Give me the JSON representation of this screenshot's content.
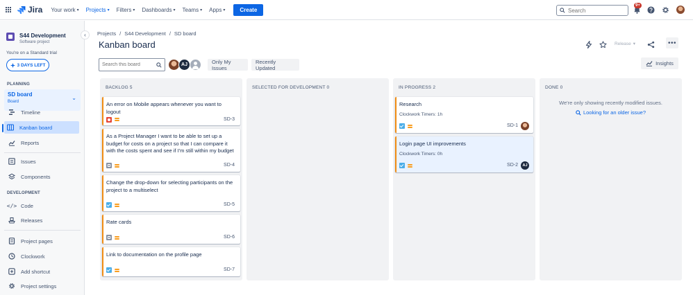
{
  "topnav": {
    "logo_text": "Jira",
    "items": [
      {
        "label": "Your work"
      },
      {
        "label": "Projects"
      },
      {
        "label": "Filters"
      },
      {
        "label": "Dashboards"
      },
      {
        "label": "Teams"
      },
      {
        "label": "Apps"
      }
    ],
    "create_label": "Create",
    "search_placeholder": "Search",
    "notifications_badge": "9+"
  },
  "sidebar": {
    "project_name": "S44 Development",
    "project_type": "Software project",
    "trial_text": "You're on a Standard trial",
    "days_left_label": "3 DAYS LEFT",
    "planning_label": "PLANNING",
    "board_name": "SD board",
    "board_sub": "Board",
    "planning_items": [
      {
        "label": "Timeline"
      },
      {
        "label": "Kanban board"
      },
      {
        "label": "Reports"
      }
    ],
    "misc_items": [
      {
        "label": "Issues"
      },
      {
        "label": "Components"
      }
    ],
    "development_label": "DEVELOPMENT",
    "development_items": [
      {
        "label": "Code"
      },
      {
        "label": "Releases"
      }
    ],
    "bottom_items": [
      {
        "label": "Project pages"
      },
      {
        "label": "Clockwork"
      },
      {
        "label": "Add shortcut"
      },
      {
        "label": "Project settings"
      }
    ]
  },
  "main": {
    "breadcrumb": [
      "Projects",
      "S44 Development",
      "SD board"
    ],
    "title": "Kanban board",
    "release_label": "Release",
    "search_placeholder": "Search this board",
    "avatar_initials": "AJ",
    "filters": [
      {
        "label": "Only My Issues"
      },
      {
        "label": "Recently Updated"
      }
    ],
    "insights_label": "Insights"
  },
  "columns": [
    {
      "title": "BACKLOG 5",
      "cards": [
        {
          "title": "An error on Mobile appears whenever you want to logout",
          "key": "SD-3",
          "type": "bug"
        },
        {
          "title": "As a Project Manager I want to be able to set up a budget for costs on a project so that I can compare it with the costs spent and see if I'm still within my budget",
          "key": "SD-4",
          "type": "story"
        },
        {
          "title": "Change the drop-down for selecting participants on the project to a multiselect",
          "key": "SD-5",
          "type": "task"
        },
        {
          "title": "Rate cards",
          "key": "SD-6",
          "type": "story"
        },
        {
          "title": "Link to documentation on the profile page",
          "key": "SD-7",
          "type": "task"
        }
      ]
    },
    {
      "title": "SELECTED FOR DEVELOPMENT 0",
      "cards": []
    },
    {
      "title": "IN PROGRESS 2",
      "cards": [
        {
          "title": "Research",
          "timer": "Clockwork Timers: 1h",
          "key": "SD-1",
          "type": "task"
        },
        {
          "title": "Login page UI improvements",
          "timer": "Clockwork Timers: 0h",
          "key": "SD-2",
          "type": "task",
          "assignee": "AJ"
        }
      ]
    },
    {
      "title": "DONE 0",
      "message": "We're only showing recently modified issues.",
      "link": "Looking for an older issue?",
      "cards": []
    }
  ],
  "colors": {
    "brand_blue": "#0c66e4",
    "card_bar": "#f18d13",
    "column_bg": "#f1f2f4"
  }
}
